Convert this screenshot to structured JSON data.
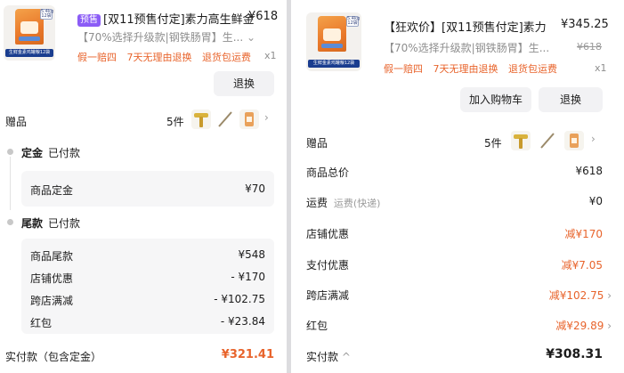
{
  "left": {
    "product": {
      "thumb_caption": "生鲜金素鸡罐粮12袋",
      "thumb_tag": "5.4kg 12袋",
      "badge": "预售",
      "title": "[双11预售付定]素力高生鲜金",
      "price": "¥618",
      "spec": "【70%选择升级款|钢铁肠胃】生...",
      "qty": "x1",
      "services": [
        "假一赔四",
        "7天无理由退换",
        "退货包运费"
      ]
    },
    "action_button": "退换",
    "gift": {
      "label": "赠品",
      "count": "5件"
    },
    "deposit": {
      "title": "定金",
      "status": "已付款",
      "rows": [
        {
          "label": "商品定金",
          "value": "¥70"
        }
      ]
    },
    "balance": {
      "title": "尾款",
      "status": "已付款",
      "rows": [
        {
          "label": "商品尾款",
          "value": "¥548"
        },
        {
          "label": "店铺优惠",
          "value": "- ¥170"
        },
        {
          "label": "跨店满减",
          "value": "- ¥102.75"
        },
        {
          "label": "红包",
          "value": "- ¥23.84"
        }
      ]
    },
    "total": {
      "label": "实付款（包含定金）",
      "value": "¥321.41"
    }
  },
  "right": {
    "product": {
      "thumb_caption": "生鲜金素鸡罐粮12袋",
      "thumb_tag": "5.4kg 12袋",
      "title": "【狂欢价】[双11预售付定]素力",
      "price": "¥345.25",
      "original_price": "¥618",
      "spec": "【70%选择升级款|钢铁肠胃】生...",
      "qty": "x1",
      "services": [
        "假一赔四",
        "7天无理由退换",
        "退货包运费"
      ]
    },
    "buttons": {
      "cart": "加入购物车",
      "return": "退换"
    },
    "gift": {
      "label": "赠品",
      "count": "5件"
    },
    "rows": [
      {
        "label": "商品总价",
        "value": "¥618",
        "note": ""
      },
      {
        "label": "运费",
        "value": "¥0",
        "note": "运费(快递)"
      },
      {
        "label": "店铺优惠",
        "value": "减¥170",
        "note": ""
      },
      {
        "label": "支付优惠",
        "value": "减¥7.05",
        "note": ""
      },
      {
        "label": "跨店满减",
        "value": "减¥102.75",
        "note": ""
      },
      {
        "label": "红包",
        "value": "减¥29.89",
        "note": ""
      }
    ],
    "total": {
      "label": "实付款",
      "value": "¥308.31"
    }
  },
  "colors": {
    "accent": "#e8642c",
    "badge": "#8b5cf6",
    "text": "#1c1c1c",
    "muted": "#9b9b9b"
  }
}
